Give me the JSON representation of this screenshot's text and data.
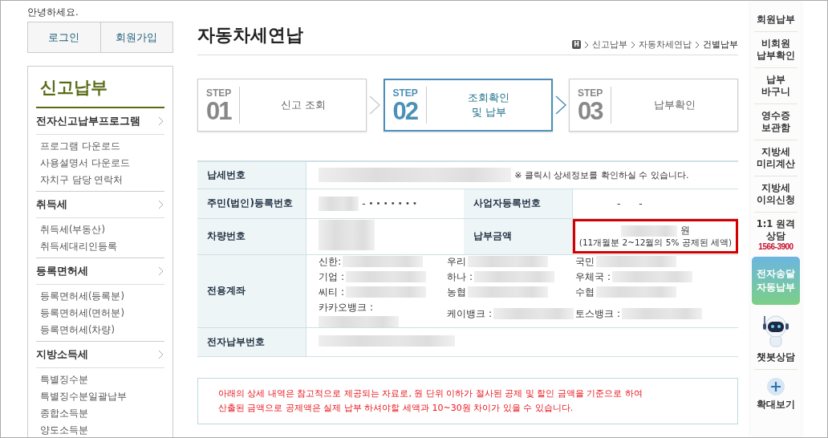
{
  "greeting": "안녕하세요.",
  "auth_buttons": [
    "로그인",
    "회원가입"
  ],
  "sidebar": {
    "title": "신고납부",
    "groups": [
      {
        "label": "전자신고납부프로그램",
        "items": [
          "프로그램 다운로드",
          "사용설명서 다운로드",
          "자치구 담당 연락처"
        ]
      },
      {
        "label": "취득세",
        "items": [
          "취득세(부동산)",
          "취득세대리인등록"
        ]
      },
      {
        "label": "등록면허세",
        "items": [
          "등록면허세(등록분)",
          "등록면허세(면허분)",
          "등록면허세(차량)"
        ]
      },
      {
        "label": "지방소득세",
        "items": [
          "특별징수분",
          "특별징수분일괄납부",
          "종합소득분",
          "양도소득분"
        ]
      }
    ]
  },
  "page_title": "자동차세연납",
  "breadcrumb": {
    "home": "H",
    "items": [
      "신고납부",
      "자동차세연납",
      "건별납부"
    ]
  },
  "steps": [
    {
      "tag": "STEP",
      "number": "01",
      "lines": [
        "신고 조회"
      ],
      "selected": false
    },
    {
      "tag": "STEP",
      "number": "02",
      "lines": [
        "조회확인",
        "및 납부"
      ],
      "selected": true
    },
    {
      "tag": "STEP",
      "number": "03",
      "lines": [
        "납부확인"
      ],
      "selected": false
    }
  ],
  "info": {
    "tax_number": {
      "label": "납세번호",
      "note": "※ 클릭시 상세정보를 확인하실 수 있습니다."
    },
    "resident": {
      "label": "주민(법인)등록번호",
      "separator": "-",
      "masked": "• • • • • • •"
    },
    "business": {
      "label": "사업자등록번호",
      "value": "-      -"
    },
    "vehicle": {
      "label": "차량번호"
    },
    "amount": {
      "label": "납부금액",
      "unit": "원",
      "note": "(11개월분 2~12월의 5% 공제된 세액)",
      "highlighted": true
    },
    "accounts": {
      "label": "전용계좌",
      "banks": [
        "신한:",
        "우리",
        "국민",
        "기업 :",
        "하나 :",
        "우체국 :",
        "씨티 :",
        "농협",
        "수협",
        "카카오뱅크 :",
        "케이뱅크 :",
        "토스뱅크 :"
      ]
    },
    "epay": {
      "label": "전자납부번호"
    }
  },
  "notice": [
    "아래의 상세 내역은 참고적으로 제공되는 자료로, 원 단위 이하가 절사된 공제 및 할인 금액을 기준으로 하여",
    "산출된 금액으로 공제액은 실제 납부 하셔야할 세액과 10~30원 차이가 있을 수 있습니다."
  ],
  "quick_menu": [
    {
      "kind": "link",
      "lines": [
        "회원납부"
      ]
    },
    {
      "kind": "link",
      "lines": [
        "비회원",
        "납부확인"
      ]
    },
    {
      "kind": "link",
      "lines": [
        "납부",
        "바구니"
      ]
    },
    {
      "kind": "link",
      "lines": [
        "영수증",
        "보관함"
      ]
    },
    {
      "kind": "link",
      "lines": [
        "지방세",
        "미리계산"
      ]
    },
    {
      "kind": "link",
      "lines": [
        "지방세",
        "이의신청"
      ]
    },
    {
      "kind": "consult",
      "lines": [
        "1:1 원격",
        "상담"
      ],
      "phone": "1566-3900"
    },
    {
      "kind": "promo",
      "lines": [
        "전자송달",
        "자동납부"
      ]
    },
    {
      "kind": "chatbot",
      "lines": [
        "챗봇상담"
      ]
    },
    {
      "kind": "zoom",
      "lines": [
        "확대보기"
      ]
    }
  ]
}
